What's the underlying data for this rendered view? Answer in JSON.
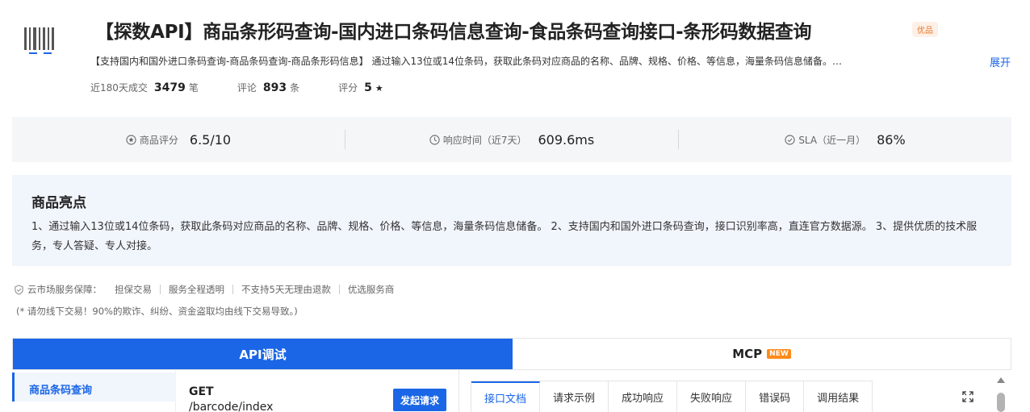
{
  "product": {
    "title": "【探数API】商品条形码查询-国内进口条码信息查询-食品条码查询接口-条形码数据查询",
    "badge": "优品",
    "description": "【支持国内和国外进口条码查询-商品条码查询-商品条形码信息】 通过输入13位或14位条码，获取此条码对应商品的名称、品牌、规格、价格、等信息，海量条码信息储备。…",
    "expand_label": "展开"
  },
  "stats": {
    "sales_label": "近180天成交",
    "sales_value": "3479",
    "sales_unit": "笔",
    "review_label": "评论",
    "review_value": "893",
    "review_unit": "条",
    "rating_label": "评分",
    "rating_value": "5",
    "rating_star": "★"
  },
  "metrics": [
    {
      "label": "商品评分",
      "value": "6.5/10",
      "icon": "star-circle-icon"
    },
    {
      "label": "响应时间（近7天）",
      "value": "609.6ms",
      "icon": "clock-icon"
    },
    {
      "label": "SLA（近一月）",
      "value": "86%",
      "icon": "check-circle-icon"
    }
  ],
  "highlights": {
    "heading": "商品亮点",
    "text": "1、通过输入13位或14位条码，获取此条码对应商品的名称、品牌、规格、价格、等信息，海量条码信息储备。 2、支持国内和国外进口条码查询，接口识别率高，直连官方数据源。 3、提供优质的技术服务，专人答疑、专人对接。"
  },
  "guarantee": {
    "lead": "云市场服务保障：",
    "items": [
      "担保交易",
      "服务全程透明",
      "不支持5天无理由退款",
      "优选服务商"
    ],
    "warning": "(* 请勿线下交易！90%的欺诈、纠纷、资金盗取均由线下交易导致。)"
  },
  "tabs": {
    "api": "API调试",
    "mcp": "MCP",
    "new_badge": "NEW"
  },
  "sidebar": {
    "items": [
      {
        "label": "商品条码查询"
      }
    ]
  },
  "request": {
    "method": "GET",
    "path": "/barcode/index",
    "send_label": "发起请求"
  },
  "doc_tabs": [
    "接口文档",
    "请求示例",
    "成功响应",
    "失败响应",
    "错误码",
    "调用结果"
  ],
  "colors": {
    "accent": "#1a66e6",
    "badge_orange": "#e8772e",
    "new_badge": "#ff8a1a"
  }
}
